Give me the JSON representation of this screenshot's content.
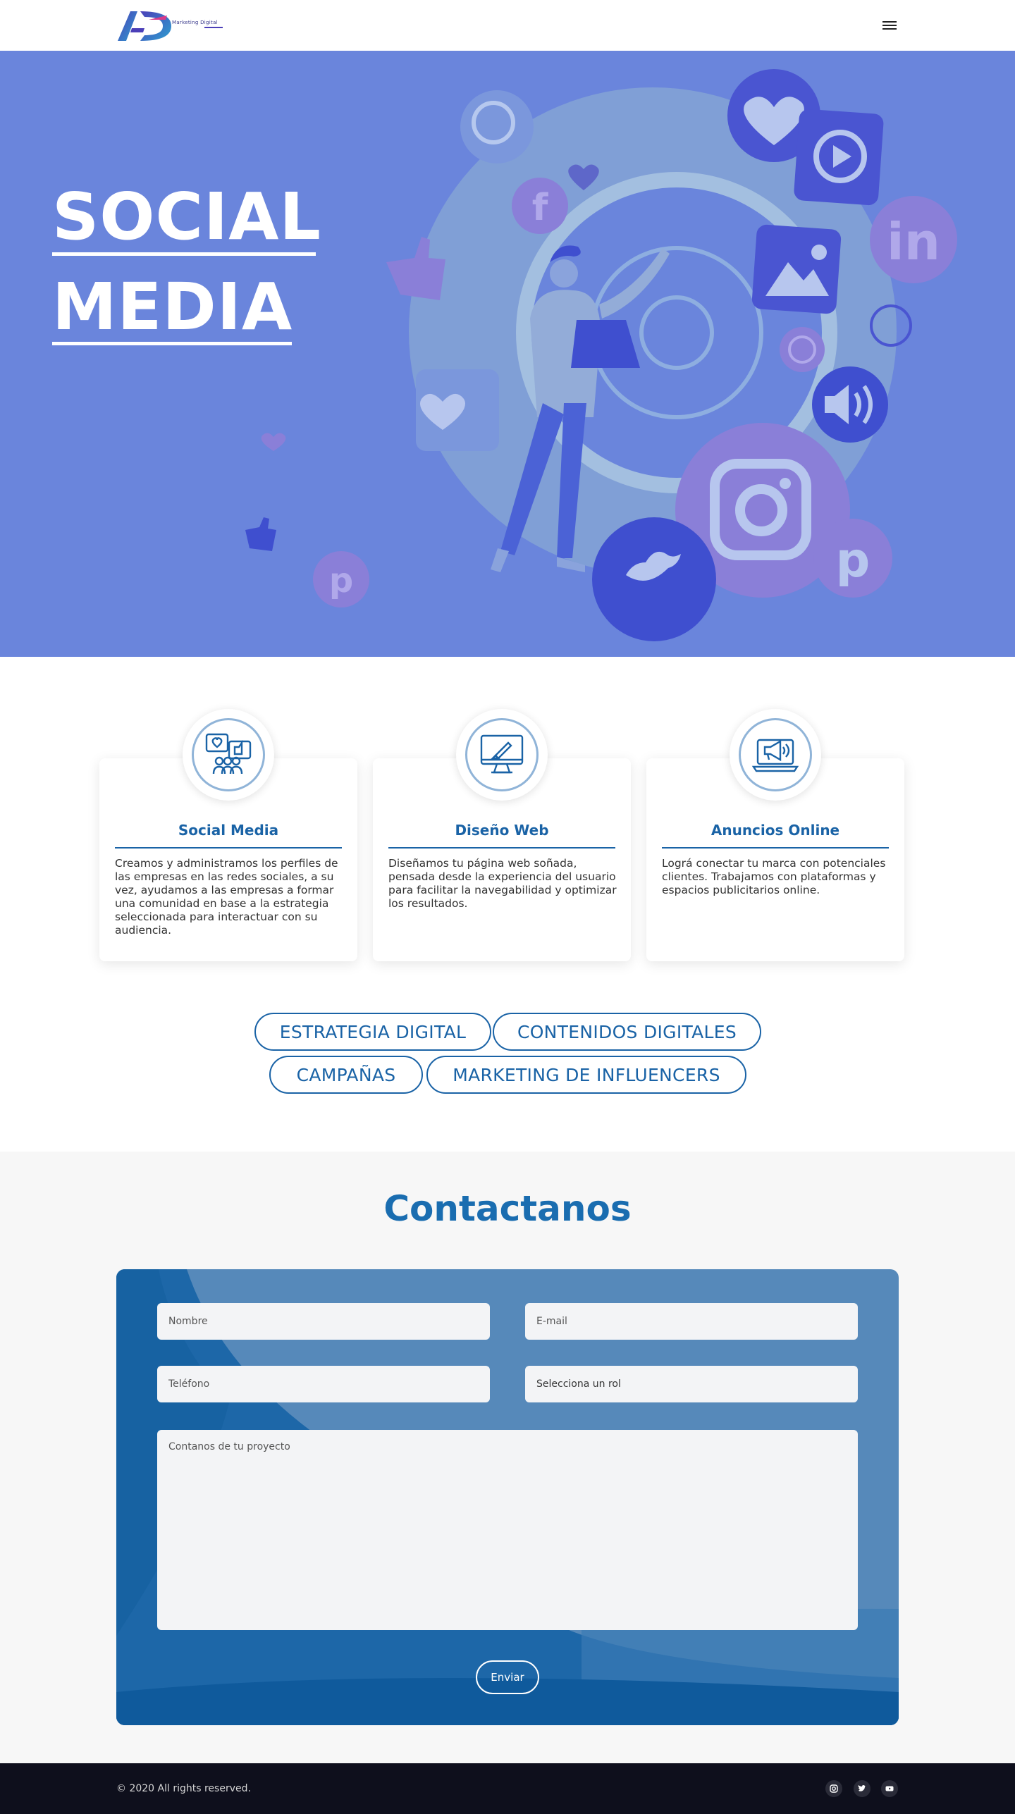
{
  "header": {
    "logo_text": "Marketing Digital",
    "menu_icon": "hamburger-menu-icon"
  },
  "hero": {
    "title_line1": "SOCIAL",
    "title_line2": "MEDIA",
    "background_color": "#6a85dc"
  },
  "services": {
    "cards": [
      {
        "icon": "social-media-icon",
        "title": "Social Media",
        "text": "Creamos y administramos los perfiles de las empresas en las redes sociales, a su vez, ayudamos a las empresas a formar una comunidad en base a la estrategia seleccionada para interactuar con su audiencia."
      },
      {
        "icon": "web-design-icon",
        "title": "Diseño Web",
        "text": "Diseñamos tu página web soñada, pensada desde la experiencia del usuario para facilitar la navegabilidad y optimizar los resultados."
      },
      {
        "icon": "online-ads-icon",
        "title": "Anuncios Online",
        "text": "Lográ conectar tu marca con potenciales clientes. Trabajamos con plataformas y espacios publicitarios online."
      }
    ],
    "pills": [
      "ESTRATEGIA DIGITAL",
      "CONTENIDOS DIGITALES",
      "CAMPAÑAS",
      "MARKETING DE INFLUENCERS"
    ]
  },
  "contact": {
    "title": "Contactanos",
    "name_placeholder": "Nombre",
    "email_placeholder": "E-mail",
    "phone_placeholder": "Teléfono",
    "role_placeholder": "Selecciona un rol",
    "message_placeholder": "Contanos de tu proyecto",
    "submit_label": "Enviar"
  },
  "footer": {
    "copyright": "© 2020 All rights reserved.",
    "social_icons": [
      "instagram-icon",
      "twitter-icon",
      "youtube-icon"
    ]
  },
  "colors": {
    "accent": "#1a63a6",
    "title_blue": "#1a6db0",
    "form_blue": "#5689ba",
    "footer_bg": "#0e0f1c"
  }
}
